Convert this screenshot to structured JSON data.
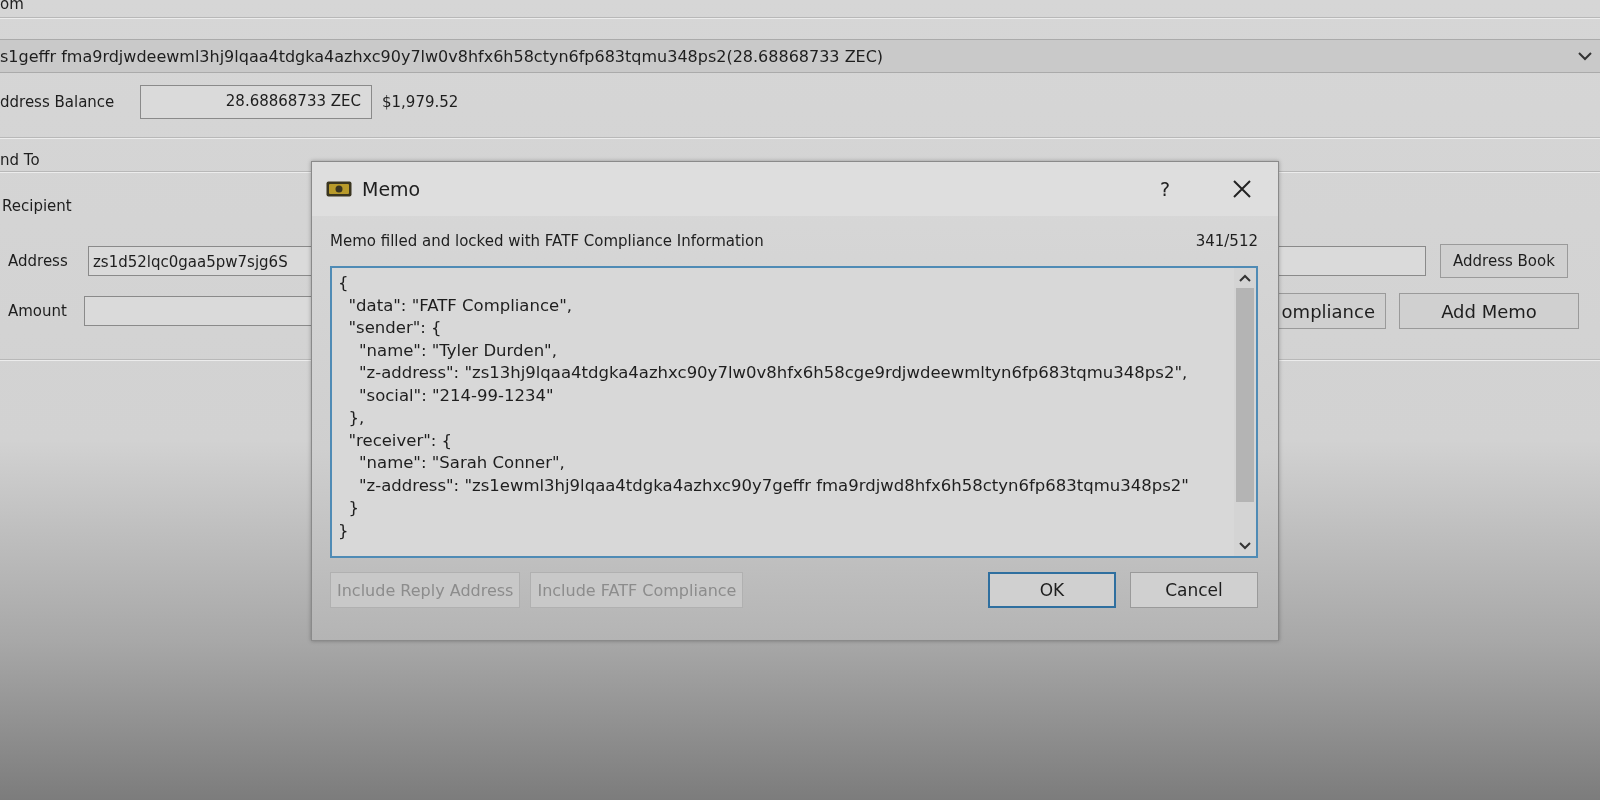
{
  "background_window": {
    "from_label": "om",
    "from_address": "s1geffr fma9rdjwdeewml3hj9lqaa4tdgka4azhxc90y7lw0v8hfx6h58ctyn6fp683tqmu348ps2(28.68868733 ZEC)",
    "address_balance_label": "ddress Balance",
    "address_balance": "28.68868733 ZEC",
    "balance_usd": "$1,979.52",
    "send_to_label": "nd To",
    "recipient_label": "Recipient",
    "address_label": "Address",
    "address_value": "zs1d52lqc0gaa5pw7sjg6S",
    "address_book_button": "Address Book",
    "amount_label": "Amount",
    "buttons": [
      {
        "label": "ompliance"
      },
      {
        "label": "Add Memo"
      }
    ]
  },
  "dialog": {
    "title": "Memo",
    "help": "?",
    "status": "Memo filled and locked with FATF Compliance Information",
    "counter": "341/512",
    "memo_text": "{\n  \"data\": \"FATF Compliance\",\n  \"sender\": {\n    \"name\": \"Tyler Durden\",\n    \"z-address\": \"zs13hj9lqaa4tdgka4azhxc90y7lw0v8hfx6h58cge9rdjwdeewmltyn6fp683tqmu348ps2\",\n    \"social\": \"214-99-1234\"\n  },\n  \"receiver\": {\n    \"name\": \"Sarah Conner\",\n    \"z-address\": \"zs1ewml3hj9lqaa4tdgka4azhxc90y7geffr fma9rdjwd8hfx6h58ctyn6fp683tqmu348ps2\"\n  }\n}",
    "buttons": [
      {
        "label": "Include Reply Address",
        "kind": "left",
        "disabled": true,
        "default": false
      },
      {
        "label": "Include FATF Compliance",
        "kind": "left",
        "disabled": true,
        "default": false
      },
      {
        "label": "OK",
        "kind": "right",
        "disabled": false,
        "default": true
      },
      {
        "label": "Cancel",
        "kind": "right",
        "disabled": false,
        "default": false
      }
    ]
  }
}
